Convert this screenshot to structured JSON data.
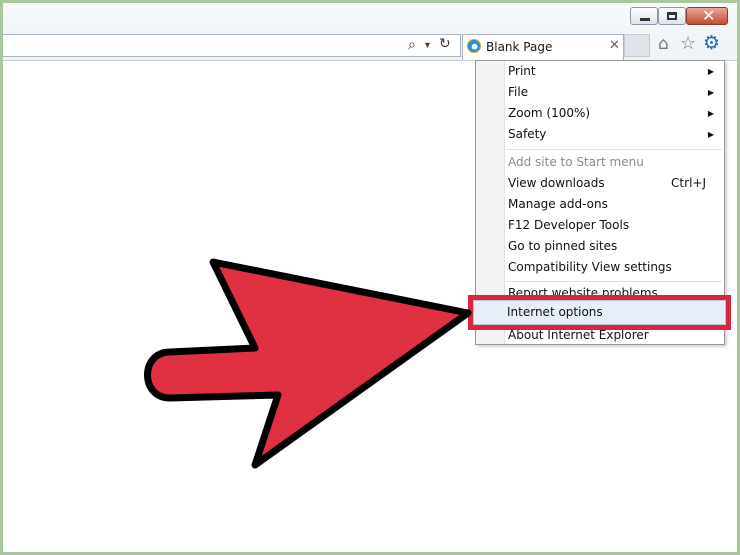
{
  "browser": {
    "tab_title": "Blank Page",
    "window_controls": {
      "minimize_icon": "minimize-icon",
      "maximize_icon": "maximize-icon",
      "close_icon": "close-icon"
    },
    "toolbar_icons": [
      "search-icon",
      "dropdown-icon",
      "refresh-icon",
      "home-icon",
      "favorites-star-icon",
      "gear-icon"
    ]
  },
  "tools_menu": {
    "items": [
      {
        "label": "Print",
        "submenu": true
      },
      {
        "label": "File",
        "submenu": true
      },
      {
        "label": "Zoom (100%)",
        "submenu": true
      },
      {
        "label": "Safety",
        "submenu": true
      },
      {
        "label": "Add site to Start menu",
        "disabled": true
      },
      {
        "label": "View downloads",
        "shortcut": "Ctrl+J"
      },
      {
        "label": "Manage add-ons"
      },
      {
        "label": "F12 Developer Tools"
      },
      {
        "label": "Go to pinned sites"
      },
      {
        "label": "Compatibility View settings"
      },
      {
        "label": "Report website problems"
      },
      {
        "label": "Internet options",
        "highlighted": true
      },
      {
        "label": "About Internet Explorer"
      }
    ]
  },
  "colors": {
    "highlight": "#d7263d",
    "arrow_fill": "#e03142",
    "border_green": "#a9c79a",
    "gear_blue": "#1d6fb8"
  }
}
